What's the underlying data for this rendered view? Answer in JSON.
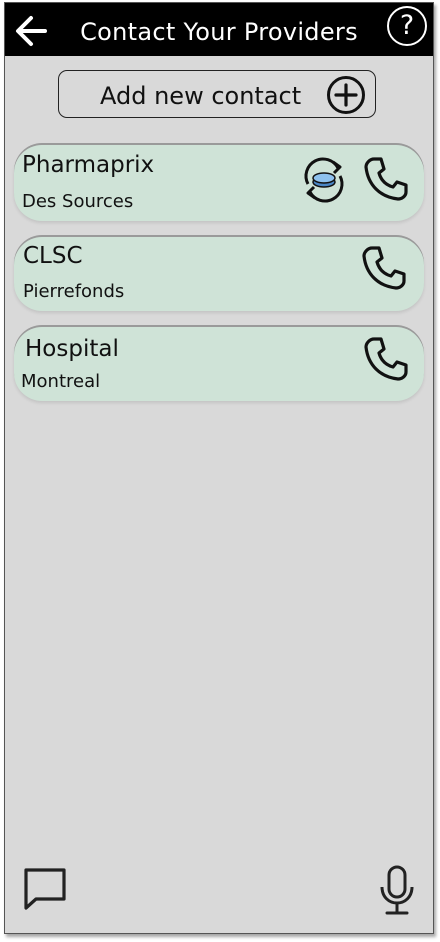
{
  "header": {
    "title": "Contact Your Providers",
    "help_symbol": "?"
  },
  "add_contact": {
    "label": "Add new contact"
  },
  "contacts": [
    {
      "name": "Pharmaprix",
      "location": "Des Sources",
      "has_refill": true
    },
    {
      "name": "CLSC",
      "location": "Pierrefonds",
      "has_refill": false
    },
    {
      "name": "Hospital",
      "location": "Montreal",
      "has_refill": false
    }
  ],
  "icons": {
    "back": "arrow-left-icon",
    "help": "question-mark-icon",
    "add": "plus-circle-icon",
    "refill": "pill-refill-icon",
    "call": "phone-icon",
    "chat": "chat-bubble-icon",
    "voice": "microphone-icon"
  },
  "colors": {
    "header_bg": "#000000",
    "card_bg": "#cfe3d7",
    "screen_bg": "#d9d9d9",
    "pill": "#5b9bd5"
  }
}
